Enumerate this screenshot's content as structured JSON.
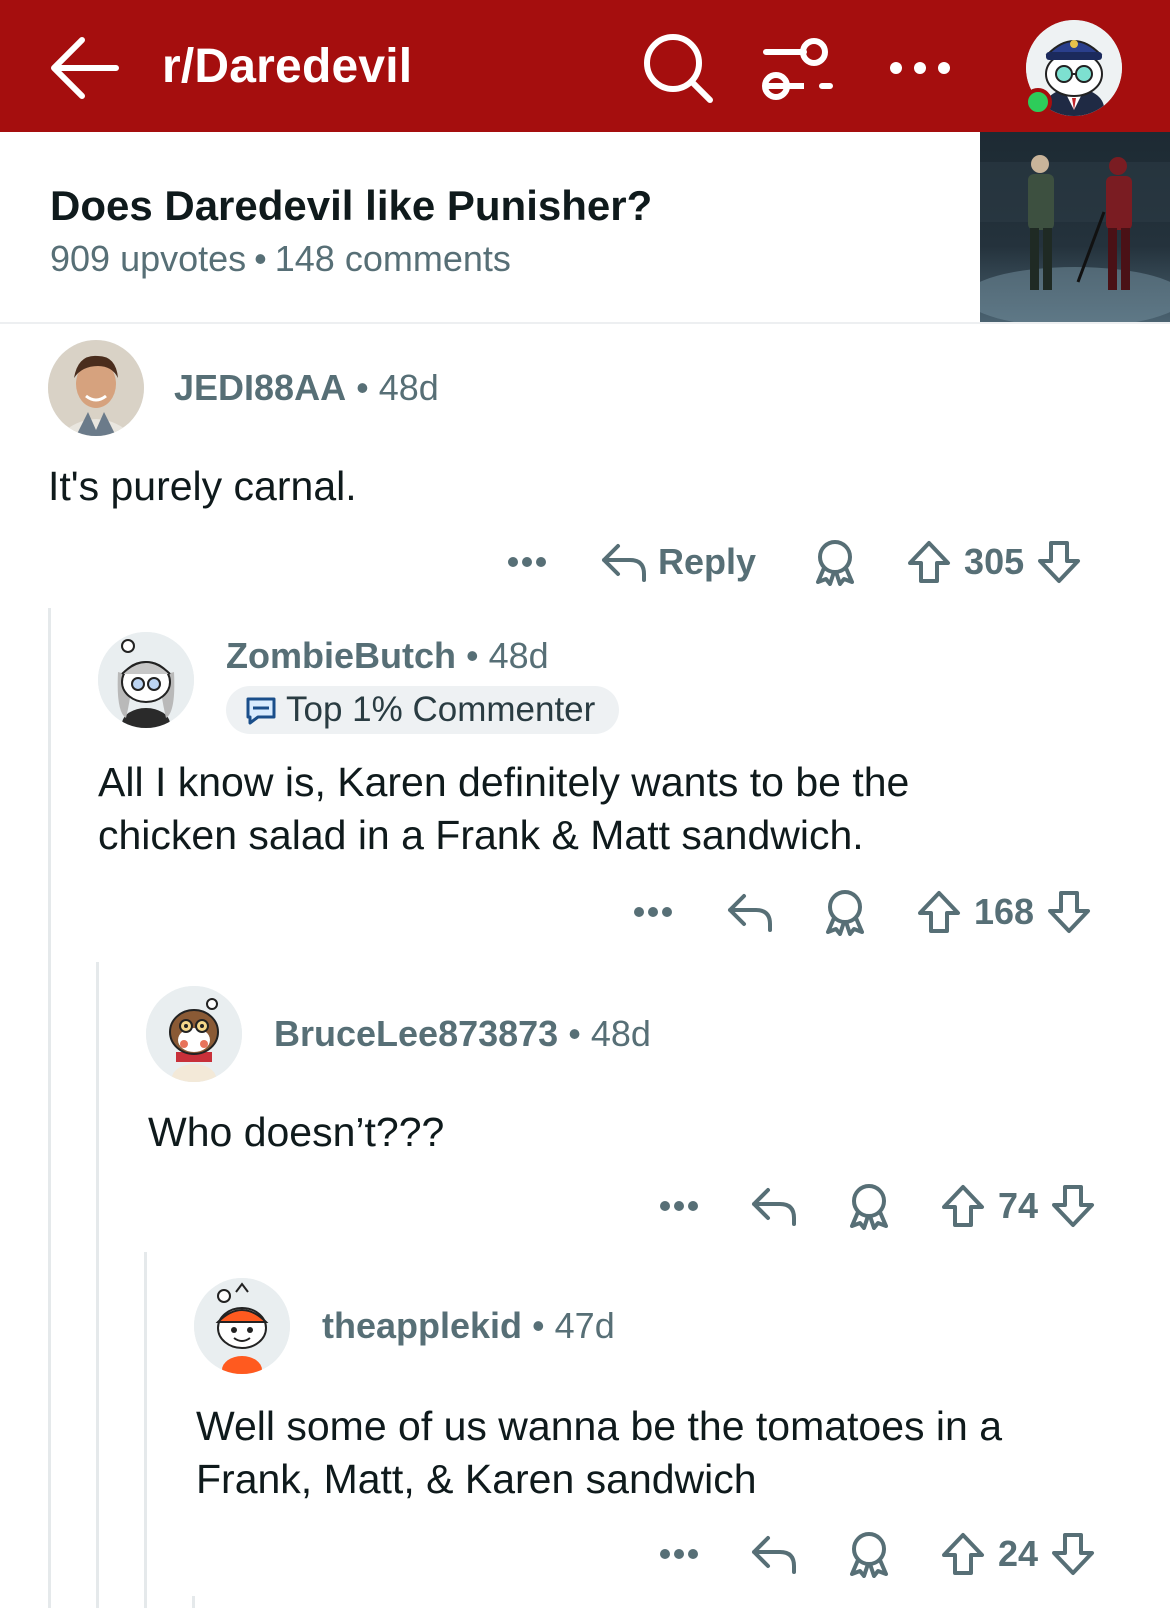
{
  "header": {
    "subreddit": "r/Daredevil",
    "icons": [
      "back-arrow-icon",
      "search-icon",
      "filter-icon",
      "more-icon",
      "user-avatar"
    ],
    "color": "#a50e0e"
  },
  "post": {
    "title": "Does Daredevil like Punisher?",
    "upvotes": "909 upvotes",
    "separator": "•",
    "comments": "148 comments"
  },
  "comments": [
    {
      "user": "JEDI88AA",
      "age": "48d",
      "body": "It's purely carnal.",
      "reply_label": "Reply",
      "score": "305"
    },
    {
      "user": "ZombieButch",
      "age": "48d",
      "flair": "Top 1% Commenter",
      "body": "All I know is, Karen definitely wants to be the chicken salad in a Frank & Matt sandwich.",
      "score": "168"
    },
    {
      "user": "BruceLee873873",
      "age": "48d",
      "body": "Who doesn’t???",
      "score": "74"
    },
    {
      "user": "theapplekid",
      "age": "47d",
      "body": "Well some of us wanna be the tomatoes in a Frank, Matt, & Karen sandwich",
      "score": "24"
    }
  ],
  "dot": "•"
}
